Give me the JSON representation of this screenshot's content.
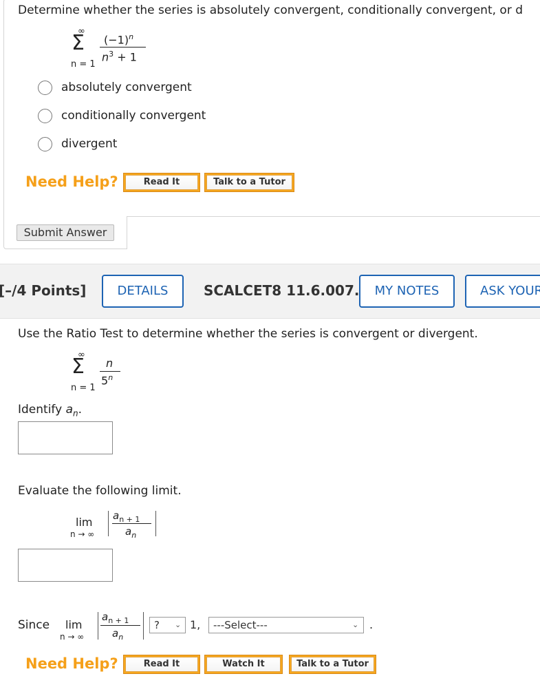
{
  "q1": {
    "prompt": "Determine whether the series is absolutely convergent, conditionally convergent, or d",
    "series": {
      "sigma": "Σ",
      "upper": "∞",
      "lower": "n = 1",
      "numerator": "(−1)",
      "numerator_exp": "n",
      "denominator": "n",
      "denominator_exp": "3",
      "denominator_rest": " + 1"
    },
    "options": [
      "absolutely convergent",
      "conditionally convergent",
      "divergent"
    ],
    "need_help": "Need Help?",
    "read_it": "Read It",
    "talk_to_tutor": "Talk to a Tutor",
    "submit": "Submit Answer"
  },
  "q2": {
    "points": "[–/4 Points]",
    "details": "DETAILS",
    "problem_id": "SCALCET8 11.6.007.",
    "my_notes": "MY NOTES",
    "ask_your": "ASK YOUR",
    "prompt": "Use the Ratio Test to determine whether the series is convergent or divergent.",
    "series": {
      "sigma": "Σ",
      "upper": "∞",
      "lower": "n = 1",
      "numerator": "n",
      "denominator": "5",
      "denominator_exp": "n"
    },
    "identify_label": "Identify ",
    "identify_var": "a",
    "identify_sub": "n",
    "identify_end": ".",
    "evaluate_label": "Evaluate the following limit.",
    "lim": "lim",
    "lim_sub": "n → ∞",
    "frac_num": "a",
    "frac_num_sub": "n + 1",
    "frac_den": "a",
    "frac_den_sub": "n",
    "since": "Since",
    "compare_select": "?",
    "one": "1,",
    "select_placeholder": "---Select---",
    "period": ".",
    "need_help": "Need Help?",
    "read_it": "Read It",
    "watch_it": "Watch It",
    "talk_to_tutor": "Talk to a Tutor"
  }
}
